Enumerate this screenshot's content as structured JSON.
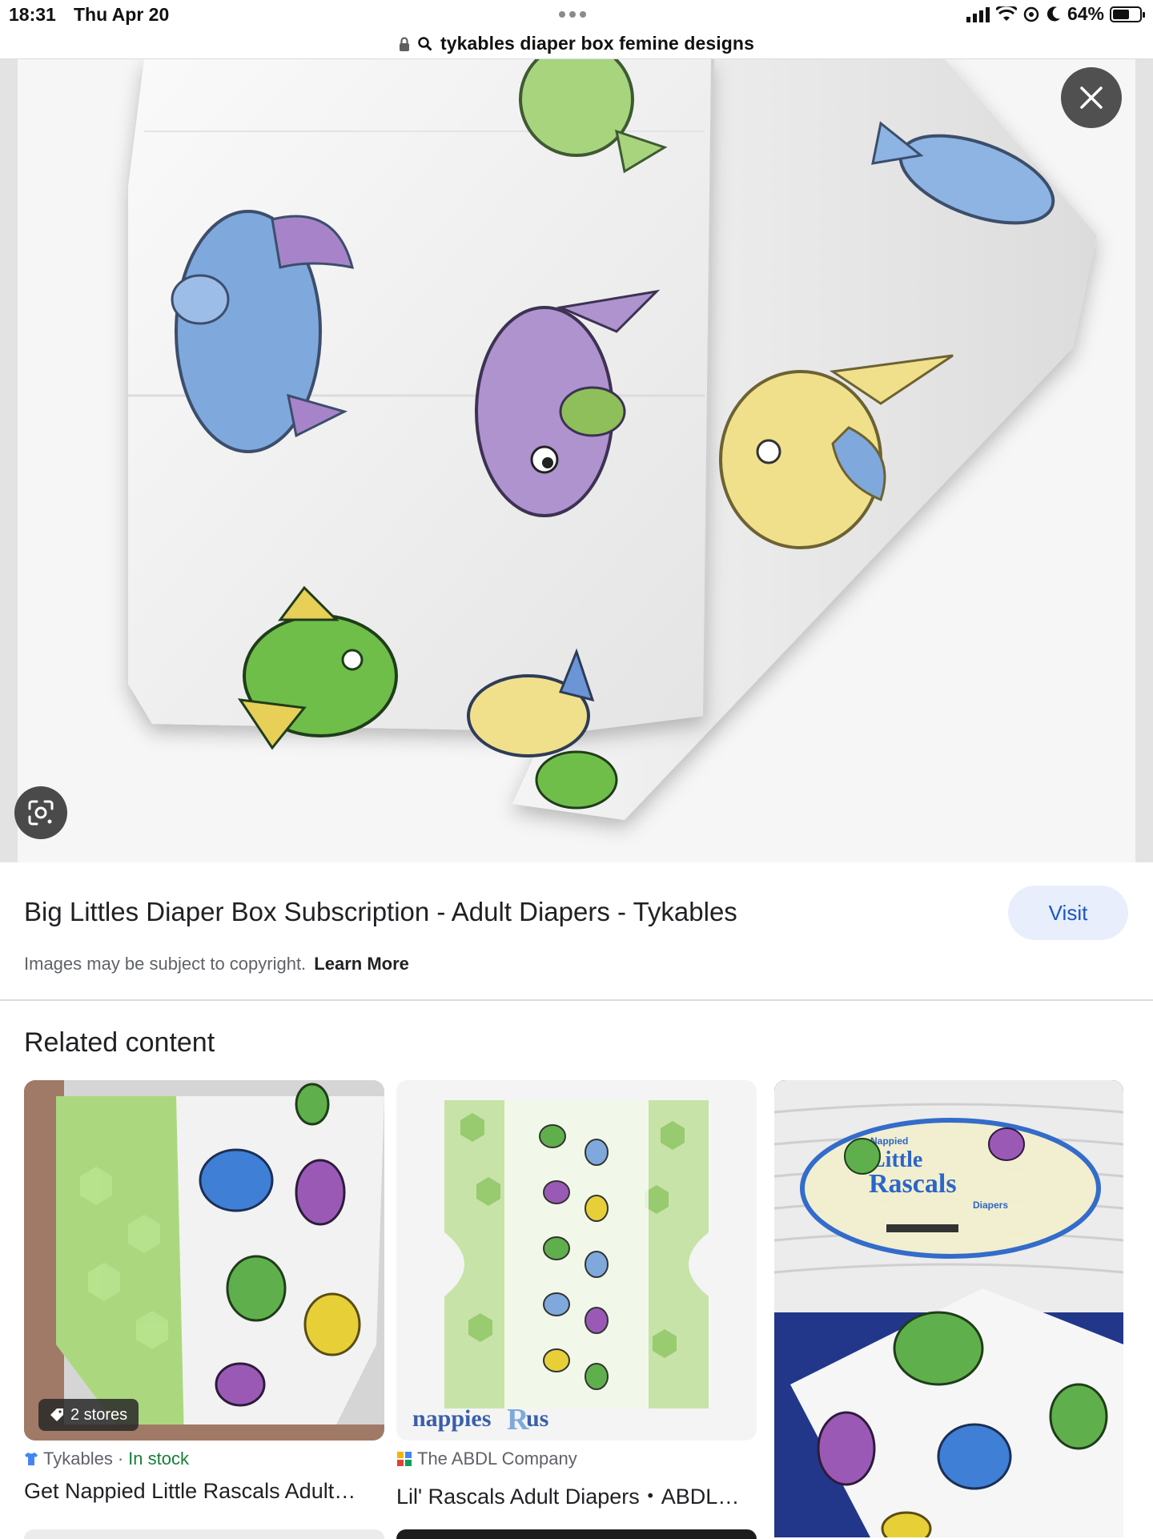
{
  "status_bar": {
    "time": "18:31",
    "date": "Thu Apr 20",
    "battery": "64%",
    "battery_level": 0.64
  },
  "url_bar": {
    "query": "tykables diaper box femine designs"
  },
  "hero": {
    "close_label": "close",
    "lens_label": "search inside image"
  },
  "result": {
    "title": "Big Littles Diaper Box Subscription - Adult Diapers - Tykables",
    "visit_label": "Visit",
    "copyright_text": "Images may be subject to copyright.",
    "learn_more": "Learn More"
  },
  "related": {
    "heading": "Related content",
    "cards": [
      {
        "badge": "2 stores",
        "source": "Tykables",
        "separator": "·",
        "stock": "In stock",
        "title": "Get Nappied Little Rascals Adult…"
      },
      {
        "source": "The ABDL Company",
        "title": "Lil' Rascals Adult Diapers・ABDL…",
        "logo_text": "nappies",
        "logo_r": "R",
        "logo_us": "us"
      },
      {
        "package_small": "Nappied",
        "package_line1": "Little",
        "package_line2": "Rascals",
        "package_line3": "Diapers"
      }
    ]
  },
  "colors": {
    "visit_bg": "#e8eefb",
    "visit_text": "#1a56c6",
    "in_stock": "#188038",
    "hero_bg": "#f6f6f6"
  }
}
